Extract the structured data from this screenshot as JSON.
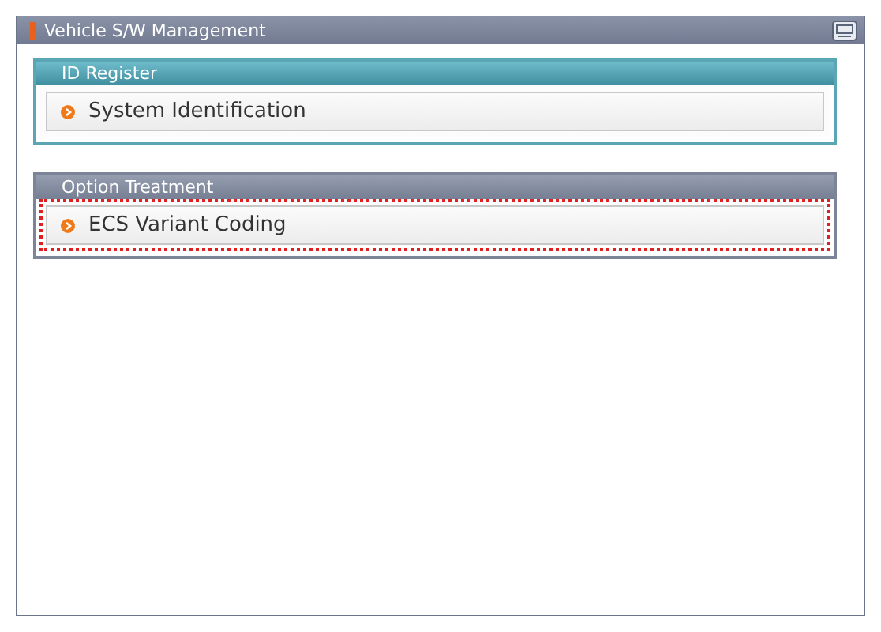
{
  "window": {
    "title": "Vehicle S/W Management"
  },
  "sections": [
    {
      "title": "ID Register",
      "kind": "teal",
      "items": [
        {
          "label": "System Identification",
          "highlighted": false
        }
      ]
    },
    {
      "title": "Option Treatment",
      "kind": "slate",
      "items": [
        {
          "label": "ECS Variant Coding",
          "highlighted": true
        }
      ]
    }
  ]
}
